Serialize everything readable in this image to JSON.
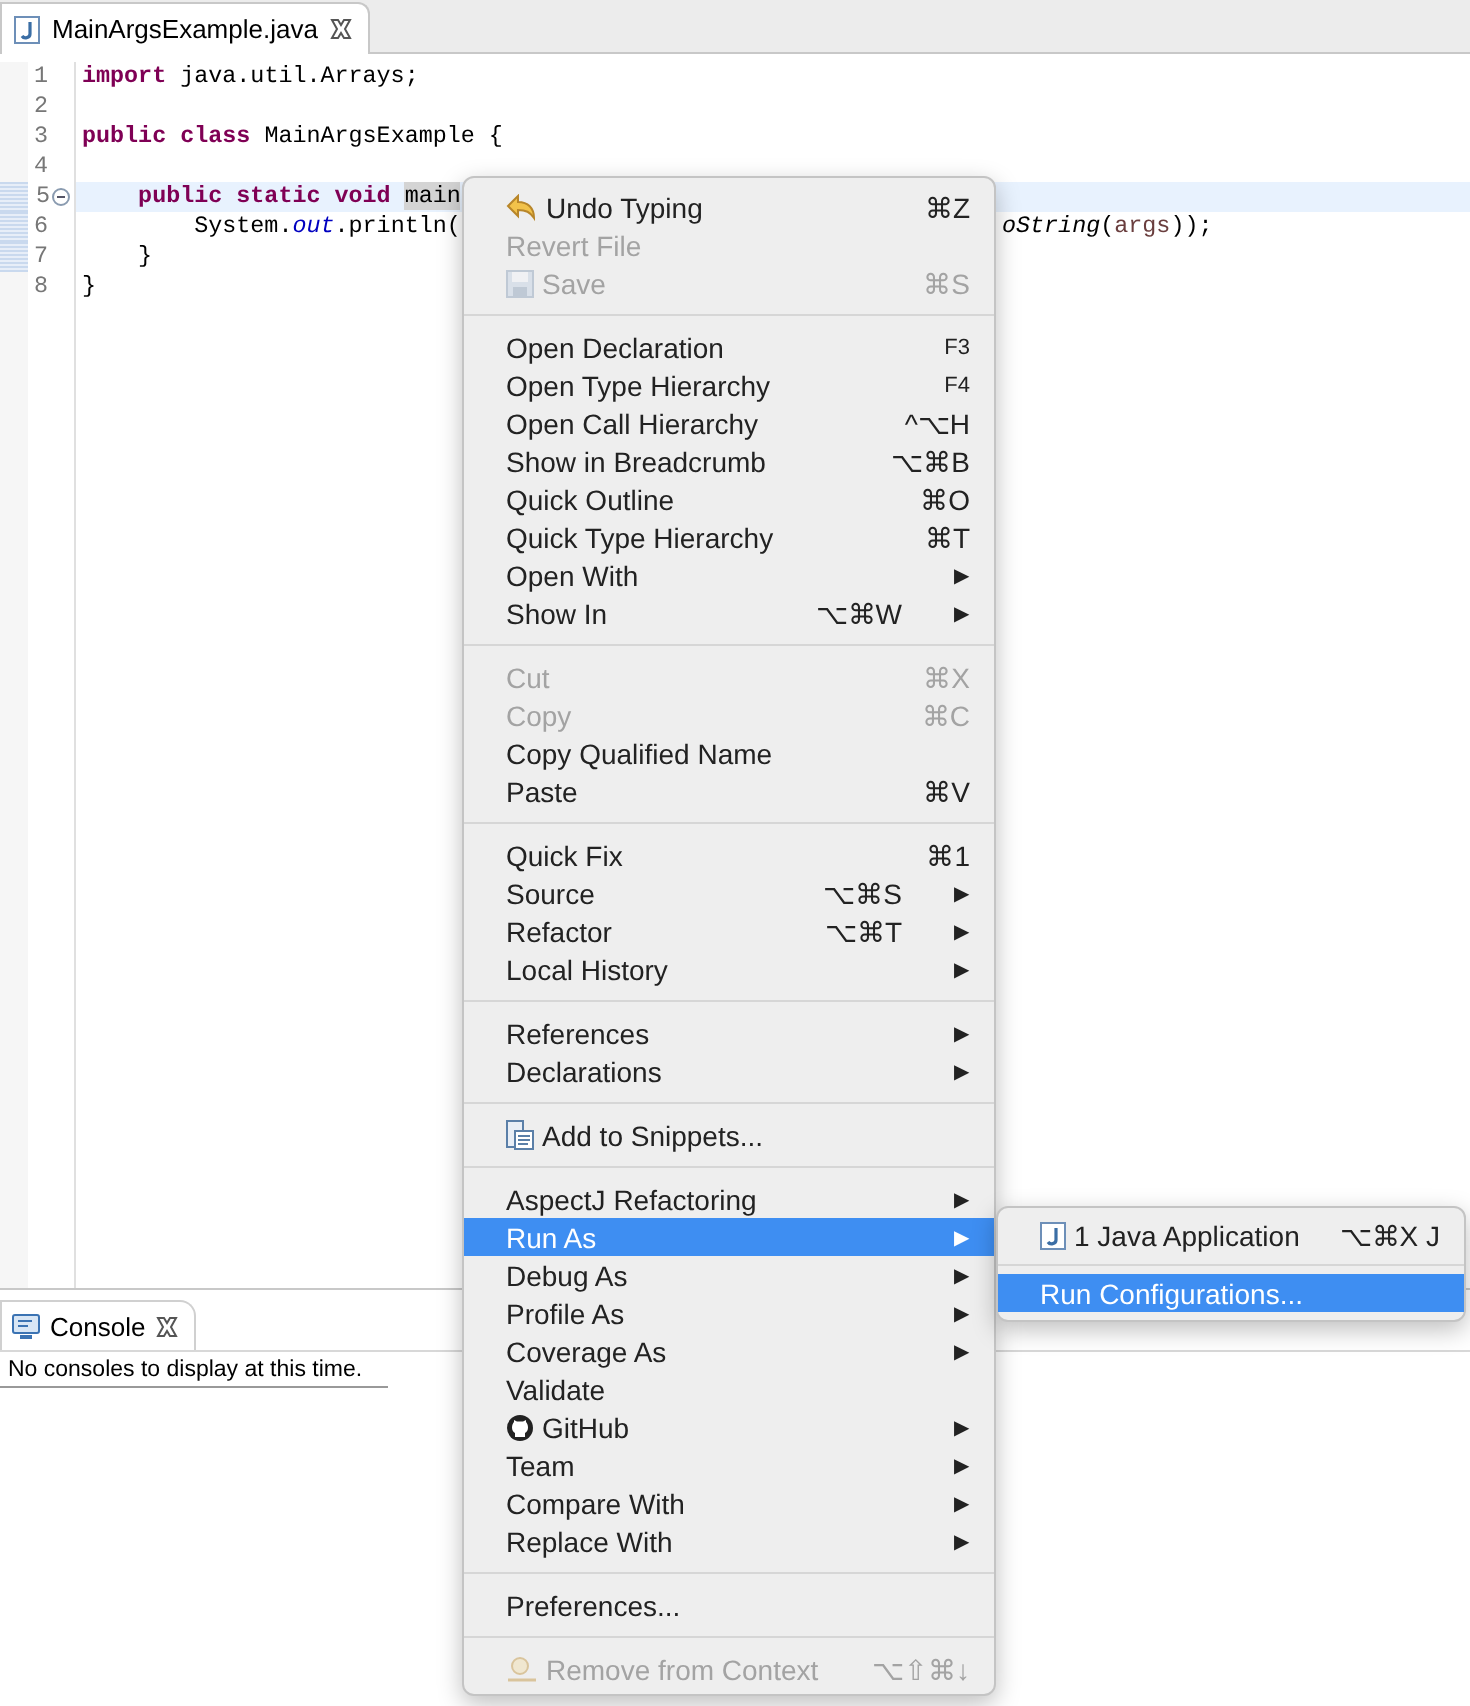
{
  "editor": {
    "tab": {
      "title": "MainArgsExample.java",
      "selected": true
    },
    "lines": [
      {
        "number": "1",
        "current": false,
        "folding": false,
        "segments": [
          {
            "kind": "keyword",
            "text": "import"
          },
          {
            "kind": "plain",
            "text": " java.util.Arrays;"
          }
        ]
      },
      {
        "number": "2",
        "current": false,
        "folding": false
      },
      {
        "number": "3",
        "current": false,
        "folding": false,
        "segments": [
          {
            "kind": "keyword",
            "text": "public"
          },
          {
            "kind": "keyword",
            "text": " class"
          },
          {
            "kind": "plain",
            "text": " MainArgsExample {"
          }
        ]
      },
      {
        "number": "4",
        "current": false,
        "folding": false
      },
      {
        "number": "5",
        "current": true,
        "folding": true,
        "segments": [
          {
            "kind": "keyword",
            "text": "    public"
          },
          {
            "kind": "keyword",
            "text": " static"
          },
          {
            "kind": "keyword",
            "text": " void "
          },
          {
            "kind": "occurrence",
            "text": "main"
          }
        ]
      },
      {
        "number": "6",
        "current": false,
        "folding": false,
        "segments": [
          {
            "kind": "plain",
            "text": "        System."
          },
          {
            "kind": "field",
            "text": "out"
          },
          {
            "kind": "plain",
            "text": ".println("
          }
        ],
        "continued": [
          {
            "kind": "static",
            "text": "oString"
          },
          {
            "kind": "plain",
            "text": "("
          },
          {
            "kind": "param",
            "text": "args"
          },
          {
            "kind": "plain",
            "text": "));"
          }
        ]
      },
      {
        "number": "7",
        "current": false,
        "folding": false,
        "segments": [
          {
            "kind": "plain",
            "text": "    }"
          }
        ]
      },
      {
        "number": "8",
        "current": false,
        "folding": false,
        "segments": [
          {
            "kind": "plain",
            "text": "}"
          }
        ]
      }
    ]
  },
  "console": {
    "tab": {
      "title": "Console",
      "selected": true
    },
    "message": "No consoles to display at this time."
  },
  "context_menu": {
    "sections": [
      {
        "items": [
          {
            "label": "Undo Typing",
            "shortcut": "⌘Z",
            "kind": "undo",
            "disabled": false,
            "selected": false
          },
          {
            "label": "Revert File",
            "kind": "plain",
            "disabled": true,
            "selected": false
          },
          {
            "label": "Save",
            "shortcut": "⌘S",
            "kind": "save",
            "disabled": true,
            "selected": false
          }
        ]
      },
      {
        "items": [
          {
            "label": "Open Declaration",
            "shortcut": "F3",
            "kind": "plain",
            "disabled": false,
            "selected": false
          },
          {
            "label": "Open Type Hierarchy",
            "shortcut": "F4",
            "kind": "plain",
            "disabled": false,
            "selected": false
          },
          {
            "label": "Open Call Hierarchy",
            "shortcut": "^⌥H",
            "kind": "plain",
            "disabled": false,
            "selected": false
          },
          {
            "label": "Show in Breadcrumb",
            "shortcut": "⌥⌘B",
            "kind": "plain",
            "disabled": false,
            "selected": false
          },
          {
            "label": "Quick Outline",
            "shortcut": "⌘O",
            "kind": "plain",
            "disabled": false,
            "selected": false
          },
          {
            "label": "Quick Type Hierarchy",
            "shortcut": "⌘T",
            "kind": "plain",
            "disabled": false,
            "selected": false
          },
          {
            "label": "Open With",
            "arrow": "▶",
            "kind": "plain",
            "disabled": false,
            "selected": false
          },
          {
            "label": "Show In",
            "shortcut": "⌥⌘W",
            "arrow": "▶",
            "kind": "plain",
            "disabled": false,
            "selected": false
          }
        ]
      },
      {
        "items": [
          {
            "label": "Cut",
            "shortcut": "⌘X",
            "kind": "plain",
            "disabled": true,
            "selected": false
          },
          {
            "label": "Copy",
            "shortcut": "⌘C",
            "kind": "plain",
            "disabled": true,
            "selected": false
          },
          {
            "label": "Copy Qualified Name",
            "kind": "plain",
            "disabled": false,
            "selected": false
          },
          {
            "label": "Paste",
            "shortcut": "⌘V",
            "kind": "plain",
            "disabled": false,
            "selected": false
          }
        ]
      },
      {
        "items": [
          {
            "label": "Quick Fix",
            "shortcut": "⌘1",
            "kind": "plain",
            "disabled": false,
            "selected": false
          },
          {
            "label": "Source",
            "shortcut": "⌥⌘S",
            "arrow": "▶",
            "kind": "plain",
            "disabled": false,
            "selected": false
          },
          {
            "label": "Refactor",
            "shortcut": "⌥⌘T",
            "arrow": "▶",
            "kind": "plain",
            "disabled": false,
            "selected": false
          },
          {
            "label": "Local History",
            "arrow": "▶",
            "kind": "plain",
            "disabled": false,
            "selected": false
          }
        ]
      },
      {
        "items": [
          {
            "label": "References",
            "arrow": "▶",
            "kind": "plain",
            "disabled": false,
            "selected": false
          },
          {
            "label": "Declarations",
            "arrow": "▶",
            "kind": "plain",
            "disabled": false,
            "selected": false
          }
        ]
      },
      {
        "items": [
          {
            "label": "Add to Snippets...",
            "kind": "snippet",
            "disabled": false,
            "selected": false
          }
        ]
      },
      {
        "items": [
          {
            "label": "AspectJ Refactoring",
            "arrow": "▶",
            "kind": "plain",
            "disabled": false,
            "selected": false
          },
          {
            "label": "Run As",
            "arrow": "▶",
            "kind": "plain",
            "disabled": false,
            "selected": true
          },
          {
            "label": "Debug As",
            "arrow": "▶",
            "kind": "plain",
            "disabled": false,
            "selected": false
          },
          {
            "label": "Profile As",
            "arrow": "▶",
            "kind": "plain",
            "disabled": false,
            "selected": false
          },
          {
            "label": "Coverage As",
            "arrow": "▶",
            "kind": "plain",
            "disabled": false,
            "selected": false
          },
          {
            "label": "Validate",
            "kind": "plain",
            "disabled": false,
            "selected": false
          },
          {
            "label": "GitHub",
            "arrow": "▶",
            "kind": "github",
            "disabled": false,
            "selected": false
          },
          {
            "label": "Team",
            "arrow": "▶",
            "kind": "plain",
            "disabled": false,
            "selected": false
          },
          {
            "label": "Compare With",
            "arrow": "▶",
            "kind": "plain",
            "disabled": false,
            "selected": false
          },
          {
            "label": "Replace With",
            "arrow": "▶",
            "kind": "plain",
            "disabled": false,
            "selected": false
          }
        ]
      },
      {
        "items": [
          {
            "label": "Preferences...",
            "kind": "plain",
            "disabled": false,
            "selected": false
          }
        ]
      },
      {
        "items": [
          {
            "label": "Remove from Context",
            "shortcut": "⌥⇧⌘↓",
            "kind": "context",
            "disabled": true,
            "selected": false
          }
        ]
      }
    ]
  },
  "submenu": {
    "sections": [
      {
        "items": [
          {
            "label": "1 Java Application",
            "shortcut": "⌥⌘X J",
            "kind": "java",
            "disabled": false,
            "selected": false
          }
        ]
      },
      {
        "items": [
          {
            "label": "Run Configurations...",
            "kind": "plain",
            "disabled": false,
            "selected": true
          }
        ]
      }
    ]
  }
}
